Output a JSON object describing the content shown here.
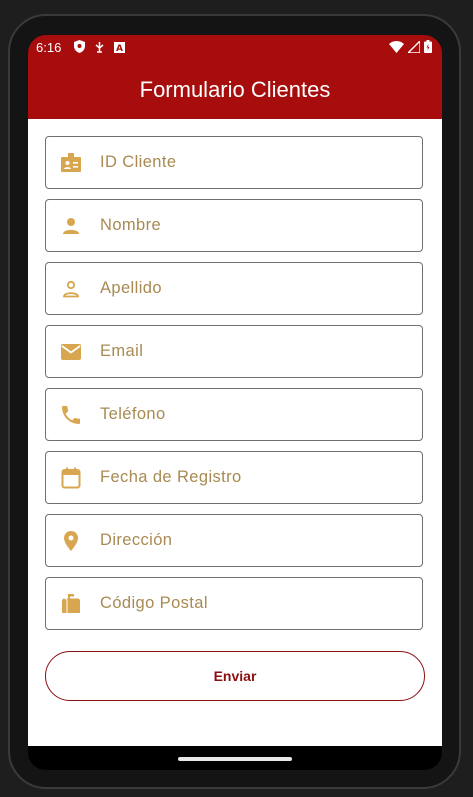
{
  "status_bar": {
    "time": "6:16",
    "icons": [
      "shield-icon",
      "debug-icon",
      "keyboard-a-icon",
      "wifi-icon",
      "cellular-icon",
      "battery-icon"
    ]
  },
  "app_bar": {
    "title": "Formulario Clientes",
    "color": "#a80d0d"
  },
  "form": {
    "fields": [
      {
        "label": "ID Cliente",
        "icon": "badge-icon"
      },
      {
        "label": "Nombre",
        "icon": "person-icon"
      },
      {
        "label": "Apellido",
        "icon": "person-outline-icon"
      },
      {
        "label": "Email",
        "icon": "email-icon"
      },
      {
        "label": "Teléfono",
        "icon": "phone-icon"
      },
      {
        "label": "Fecha de Registro",
        "icon": "calendar-icon"
      },
      {
        "label": "Dirección",
        "icon": "location-pin-icon"
      },
      {
        "label": "Código Postal",
        "icon": "mailbox-icon"
      }
    ],
    "label_color": "#a88a52",
    "icon_color": "#d9a650",
    "submit_label": "Enviar",
    "submit_color": "#8c0f0f"
  }
}
